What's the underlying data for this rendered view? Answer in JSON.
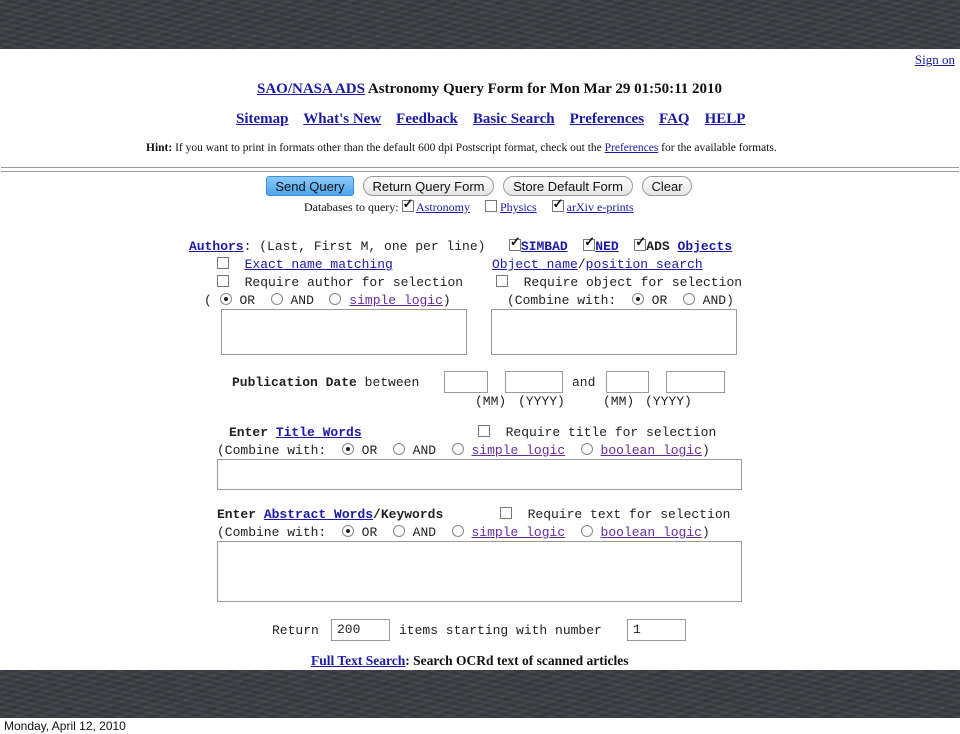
{
  "header": {
    "sign_on": "Sign on",
    "title_link": "SAO/NASA ADS",
    "title_rest": "Astronomy Query Form for Mon Mar 29 01:50:11 2010",
    "nav": [
      "Sitemap",
      "What's New",
      "Feedback",
      "Basic Search",
      "Preferences",
      "FAQ",
      "HELP"
    ],
    "hint_label": "Hint:",
    "hint_text": "If you want to print in formats other than the default 600 dpi Postscript format, check out the",
    "hint_link": "Preferences",
    "hint_tail": "for the available formats."
  },
  "buttons": {
    "send": "Send Query",
    "return_form": "Return Query Form",
    "store": "Store Default Form",
    "clear": "Clear"
  },
  "databases": {
    "label": "Databases to query:",
    "items": [
      {
        "label": "Astronomy",
        "checked": true
      },
      {
        "label": "Physics",
        "checked": false
      },
      {
        "label": "arXiv e-prints",
        "checked": true
      }
    ]
  },
  "authors": {
    "label": "Authors",
    "hint": ": (Last, First M, one per line)",
    "simbad": "SIMBAD",
    "ned": "NED",
    "ads": "ADS",
    "objects": "Objects",
    "exact": "Exact name matching",
    "require": "Require author for selection",
    "open": "(",
    "or": "OR",
    "and": "AND",
    "simple": "simple logic",
    "close": ")"
  },
  "objects": {
    "object_name": "Object name",
    "slash": "/",
    "position": "position search",
    "require": "Require object for selection",
    "combine": "(Combine with:",
    "or": "OR",
    "and": "AND)"
  },
  "pubdate": {
    "label": "Publication Date",
    "between": "between",
    "and": "and",
    "mm1": "(MM)",
    "yyyy1": "(YYYY)",
    "mm2": "(MM)",
    "yyyy2": "(YYYY)"
  },
  "title": {
    "enter": "Enter",
    "link": "Title Words",
    "require": "Require title for selection",
    "combine": "(Combine with:",
    "or": "OR",
    "and": "AND",
    "simple": "simple logic",
    "boolean": "boolean logic",
    "close": ")"
  },
  "abstract": {
    "enter": "Enter",
    "link": "Abstract Words",
    "keywords": "/Keywords",
    "require": "Require text for selection",
    "combine": "(Combine with:",
    "or": "OR",
    "and": "AND",
    "simple": "simple logic",
    "boolean": "boolean logic",
    "close": ")"
  },
  "return_row": {
    "return": "Return",
    "items_value": "200",
    "starting": "items starting with number",
    "start_value": "1"
  },
  "fulltext": {
    "link": "Full Text Search",
    "text": ": Search OCRd text of scanned articles"
  },
  "slide_date": "Monday, April 12, 2010"
}
